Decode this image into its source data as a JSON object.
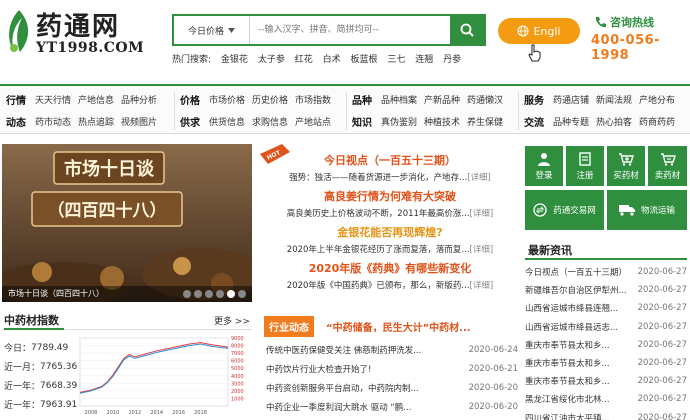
{
  "logo": {
    "cn": "药通网",
    "en": "YT1998.COM"
  },
  "search": {
    "type_label": "今日价格",
    "placeholder": "--输入汉字、拼音、简拼均可--",
    "hot_label": "热门搜索:",
    "hot_terms": [
      "金银花",
      "太子参",
      "红花",
      "白术",
      "板蓝根",
      "三七",
      "连翘",
      "丹参"
    ]
  },
  "lang_button": "Engli",
  "hotline": {
    "label": "咨询热线",
    "number": "400-056-1998"
  },
  "nav": [
    {
      "row1": {
        "head": "行情",
        "items": [
          "天天行情",
          "产地信息",
          "品种分析"
        ]
      },
      "row2": {
        "head": "动态",
        "items": [
          "药市动态",
          "热点追踪",
          "视频图片"
        ]
      }
    },
    {
      "row1": {
        "head": "价格",
        "items": [
          "市场价格",
          "历史价格",
          "市场指数"
        ]
      },
      "row2": {
        "head": "供求",
        "items": [
          "供货信息",
          "求购信息",
          "产地站点"
        ]
      }
    },
    {
      "row1": {
        "head": "品种",
        "items": [
          "品种档案",
          "产新品种",
          "药通懒汉"
        ]
      },
      "row2": {
        "head": "知识",
        "items": [
          "真伪鉴别",
          "种植技术",
          "养生保健"
        ]
      }
    },
    {
      "row1": {
        "head": "服务",
        "items": [
          "药通店铺",
          "新闻法规",
          "产地分布"
        ]
      },
      "row2": {
        "head": "交流",
        "items": [
          "品种专题",
          "热心拍客",
          "药商药药"
        ]
      }
    }
  ],
  "carousel": {
    "banner_title": "市场十日谈",
    "banner_sub": "（四百四十八）",
    "caption": "市场十日谈（四百四十八）"
  },
  "hot_tag": "HOT",
  "today_news": [
    {
      "title": "今日视点（一百五十三期）",
      "summary": "强势：独活——随着货源进一步消化，产地存...",
      "more": "[详细]"
    },
    {
      "title": "高良姜行情为何难有大突破",
      "summary": "高良美历史上价格波动不断，2011年最高价涨...",
      "more": "[详细]"
    },
    {
      "title": "金银花能否再现辉煌?",
      "summary": "2020年上半年金银花经历了涨而复落，落而复...",
      "more": "[详细]"
    },
    {
      "title": "2020年版《药典》有哪些新变化",
      "summary": "2020年版《中国药典》已颁布，那么，新版药...",
      "more": "[详细]"
    }
  ],
  "tiles": [
    {
      "label": "登录",
      "icon": "user-icon"
    },
    {
      "label": "注册",
      "icon": "register-icon"
    },
    {
      "label": "买药材",
      "icon": "cart-add-icon"
    },
    {
      "label": "卖药材",
      "icon": "cart-remove-icon"
    },
    {
      "label": "药通交易网",
      "icon": "exchange-icon"
    },
    {
      "label": "物流运输",
      "icon": "truck-icon"
    }
  ],
  "latest": {
    "title": "最新资讯",
    "items": [
      {
        "title": "今日视点（一百五十三期）",
        "date": "2020-06-27"
      },
      {
        "title": "新疆维吾尔自治区伊犁州...",
        "date": "2020-06-27"
      },
      {
        "title": "山西省运城市绛县连翘...",
        "date": "2020-06-27"
      },
      {
        "title": "山西省运城市绛县远志...",
        "date": "2020-06-27"
      },
      {
        "title": "重庆市奉节县太和乡...",
        "date": "2020-06-27"
      },
      {
        "title": "重庆市奉节县太和乡...",
        "date": "2020-06-27"
      },
      {
        "title": "重庆市奉节县太和乡...",
        "date": "2020-06-27"
      },
      {
        "title": "黑龙江省绥化市北林...",
        "date": "2020-06-27"
      },
      {
        "title": "四川省江油市太平镇...",
        "date": "2020-06-27"
      }
    ]
  },
  "index": {
    "title": "中药材指数",
    "more": "更多 >>",
    "values": [
      {
        "label": "今日：",
        "value": "7789.49"
      },
      {
        "label": "近一月：",
        "value": "7765.36"
      },
      {
        "label": "近一年：",
        "value": "7668.39"
      },
      {
        "label": "近一年：",
        "value": "7963.91"
      }
    ]
  },
  "chart_data": {
    "type": "line",
    "x_ticks": [
      "2008",
      "2010",
      "2012",
      "2014",
      "2016",
      "2018"
    ],
    "y_ticks": [
      1000,
      2000,
      3000,
      4000,
      5000,
      6000,
      7000,
      8000,
      9000
    ],
    "ylim": [
      0,
      9000
    ],
    "xlim": [
      2007,
      2020.5
    ],
    "series": [
      {
        "x": [
          2007,
          2008,
          2009,
          2009.5,
          2010,
          2010.5,
          2011,
          2011.5,
          2012,
          2013,
          2014,
          2015,
          2016,
          2017,
          2018,
          2019,
          2020,
          2020.5
        ],
        "y": [
          1800,
          2100,
          2600,
          3200,
          4100,
          5200,
          6300,
          6800,
          6500,
          6900,
          7300,
          7600,
          7900,
          8200,
          8400,
          8100,
          7900,
          7800
        ],
        "color": "#e23b3b"
      },
      {
        "x": [
          2007,
          2008,
          2009,
          2009.5,
          2010,
          2010.5,
          2011,
          2011.5,
          2012,
          2013,
          2014,
          2015,
          2016,
          2017,
          2018,
          2019,
          2020,
          2020.5
        ],
        "y": [
          1700,
          2000,
          2500,
          3100,
          3900,
          5000,
          6100,
          6600,
          6300,
          6700,
          7100,
          7400,
          7700,
          8000,
          8200,
          7900,
          7700,
          7650
        ],
        "color": "#2f8fd8"
      }
    ]
  },
  "industry": {
    "tag": "行业动态",
    "headline": "“中药储备，民生大计”中药材...",
    "items": [
      {
        "title": "传统中医药保健受关注 佛慈制药押洗发...",
        "date": "2020-06-24"
      },
      {
        "title": "中药饮片行业大检查开始了!",
        "date": "2020-06-21"
      },
      {
        "title": "中药资创新服务平台启动，中药院内制...",
        "date": "2020-06-20"
      },
      {
        "title": "中药企业一季度利润大跳水 驱动 “鹏...",
        "date": "2020-06-20"
      }
    ]
  },
  "colors": {
    "brand_green": "#2f8f3e",
    "accent_orange": "#f07c1e",
    "news_red": "#e0531a"
  }
}
